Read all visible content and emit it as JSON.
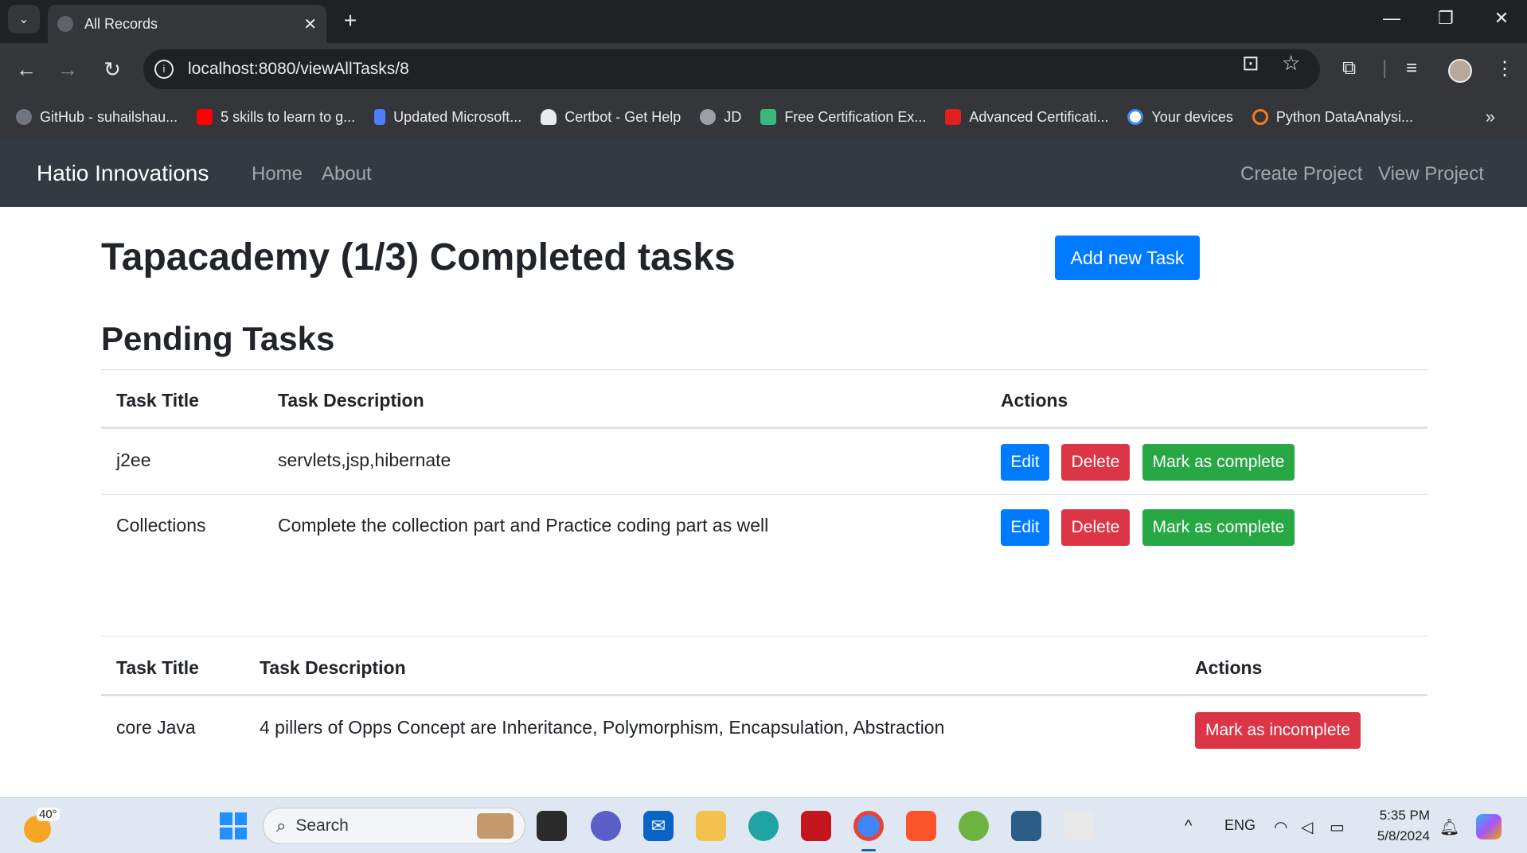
{
  "browser": {
    "tab_title": "All Records",
    "url": "localhost:8080/viewAllTasks/8",
    "bookmarks": [
      {
        "label": "GitHub - suhailshau...",
        "color": "#6e7681"
      },
      {
        "label": "5 skills to learn to g...",
        "color": "#ff0000"
      },
      {
        "label": "Updated Microsoft...",
        "color": "#4a7dff"
      },
      {
        "label": "Certbot - Get Help",
        "color": "#e8eaed"
      },
      {
        "label": "JD",
        "color": "#9aa0a6"
      },
      {
        "label": "Free Certification Ex...",
        "color": "#3bb77e"
      },
      {
        "label": "Advanced Certificati...",
        "color": "#e02020"
      },
      {
        "label": "Your devices",
        "color": "#ffffff"
      },
      {
        "label": "Python DataAnalysi...",
        "color": "#f47b20"
      }
    ]
  },
  "navbar": {
    "brand": "Hatio Innovations",
    "home": "Home",
    "about": "About",
    "create_project": "Create Project",
    "view_project": "View Project"
  },
  "page": {
    "title": "Tapacademy (1/3) Completed tasks",
    "add_task_button": "Add new Task",
    "pending_heading": "Pending Tasks"
  },
  "pending_table": {
    "headers": {
      "title": "Task Title",
      "description": "Task Description",
      "actions": "Actions"
    },
    "rows": [
      {
        "title": "j2ee",
        "description": "servlets,jsp,hibernate",
        "edit": "Edit",
        "delete": "Delete",
        "complete": "Mark as complete"
      },
      {
        "title": "Collections",
        "description": "Complete the collection part and Practice coding part as well",
        "edit": "Edit",
        "delete": "Delete",
        "complete": "Mark as complete"
      }
    ]
  },
  "completed_table": {
    "headers": {
      "title": "Task Title",
      "description": "Task Description",
      "actions": "Actions"
    },
    "rows": [
      {
        "title": "core Java",
        "description": "4 pillers of Opps Concept are Inheritance, Polymorphism, Encapsulation, Abstraction",
        "incomplete": "Mark as incomplete"
      }
    ]
  },
  "taskbar": {
    "weather": "40°",
    "search_placeholder": "Search",
    "lang": "ENG",
    "time": "5:35 PM",
    "date": "5/8/2024"
  }
}
